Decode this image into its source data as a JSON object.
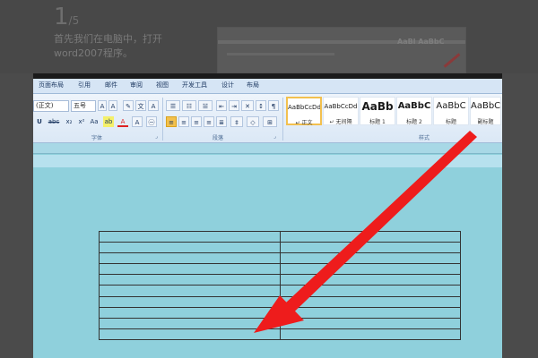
{
  "tutorial": {
    "step_number": "1",
    "step_suffix": "/5",
    "step_text": "首先我们在电脑中，打开word2007程序。",
    "thumb_text": "AaBl AaBbC"
  },
  "ribbon": {
    "tabs": [
      "页面布局",
      "引用",
      "邮件",
      "审阅",
      "视图",
      "开发工具",
      "设计",
      "布局"
    ],
    "font_name": "(正文)",
    "font_size": "五号",
    "font_group_label": "字体",
    "paragraph_group_label": "段落",
    "styles_group_label": "样式",
    "styles": [
      {
        "sample": "AaBbCcDd",
        "name": "↵ 正文",
        "selected": true
      },
      {
        "sample": "AaBbCcDd",
        "name": "↵ 无间隔",
        "selected": false
      },
      {
        "sample": "AaBb",
        "name": "标题 1",
        "selected": false
      },
      {
        "sample": "AaBbC",
        "name": "标题 2",
        "selected": false
      },
      {
        "sample": "AaBbC",
        "name": "标题",
        "selected": false
      },
      {
        "sample": "AaBbC",
        "name": "副标题",
        "selected": false
      }
    ]
  },
  "table": {
    "rows": 10,
    "cols": 2
  },
  "colors": {
    "arrow": "#ee1c1c",
    "doc_bg": "#8fd0dc",
    "style_selected_border": "#f2c04f"
  }
}
